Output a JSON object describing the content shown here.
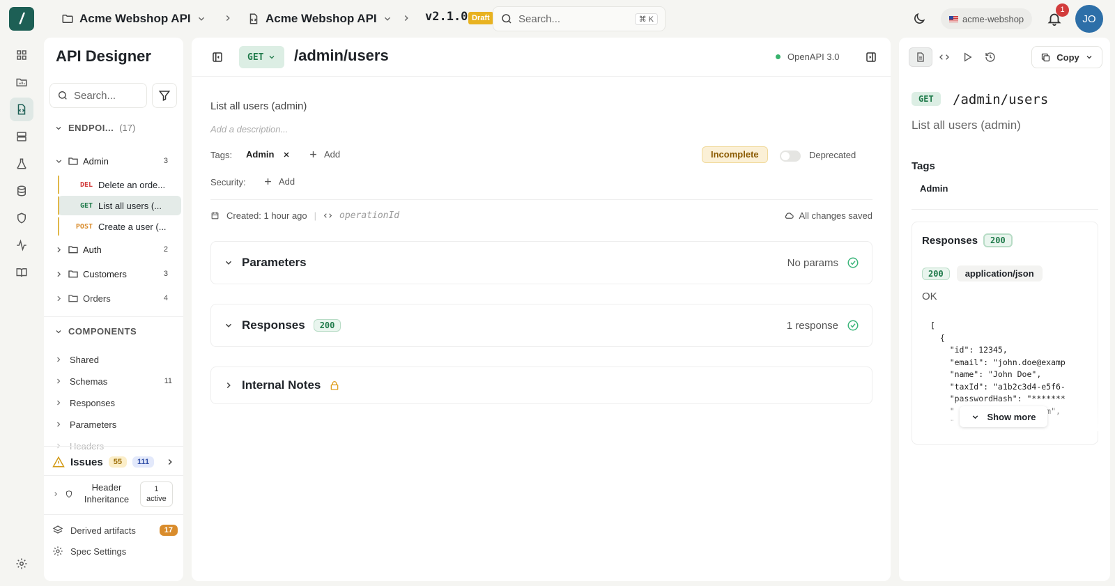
{
  "topbar": {
    "crumbs": [
      "Acme Webshop API",
      "Acme Webshop API"
    ],
    "version": "v2.1.0",
    "status_badge": "Draft",
    "search_placeholder": "Search...",
    "search_shortcut": "⌘ K",
    "workspace": "acme-webshop",
    "notification_count": "1",
    "avatar_initials": "JO"
  },
  "sidebar": {
    "title": "API Designer",
    "search_placeholder": "Search...",
    "endpoints_label": "ENDPOI...",
    "endpoints_count": "(17)",
    "groups": [
      {
        "name": "Admin",
        "count": "3"
      },
      {
        "name": "Auth",
        "count": "2"
      },
      {
        "name": "Customers",
        "count": "3"
      },
      {
        "name": "Orders",
        "count": "4"
      }
    ],
    "admin_endpoints": [
      {
        "method": "DEL",
        "label": "Delete an orde...",
        "color": "#d23c3c"
      },
      {
        "method": "GET",
        "label": "List all users (...",
        "color": "#1f7a4a"
      },
      {
        "method": "POST",
        "label": "Create a user (...",
        "color": "#d98c2c"
      }
    ],
    "components_label": "COMPONENTS",
    "components": [
      {
        "name": "Shared",
        "count": ""
      },
      {
        "name": "Schemas",
        "count": "11"
      },
      {
        "name": "Responses",
        "count": ""
      },
      {
        "name": "Parameters",
        "count": ""
      },
      {
        "name": "Headers",
        "count": ""
      }
    ],
    "issues_label": "Issues",
    "issues_warn": "55",
    "issues_info": "111",
    "header_inheritance_label": "Header Inheritance",
    "header_inheritance_badge_1": "1",
    "header_inheritance_badge_2": "active",
    "derived_label": "Derived artifacts",
    "derived_count": "17",
    "spec_settings_label": "Spec Settings"
  },
  "main": {
    "method": "GET",
    "path": "/admin/users",
    "openapi": "OpenAPI 3.0",
    "summary": "List all users (admin)",
    "description_placeholder": "Add a description...",
    "tags_label": "Tags:",
    "tag": "Admin",
    "add_label": "Add",
    "security_label": "Security:",
    "incomplete": "Incomplete",
    "deprecated": "Deprecated",
    "created": "Created: 1 hour ago",
    "operation_id_placeholder": "operationId",
    "saved": "All changes saved",
    "parameters_title": "Parameters",
    "parameters_status": "No params",
    "responses_title": "Responses",
    "responses_code": "200",
    "responses_status": "1 response",
    "notes_title": "Internal Notes"
  },
  "preview": {
    "copy_label": "Copy",
    "method": "GET",
    "path": "/admin/users",
    "summary": "List all users (admin)",
    "tags_title": "Tags",
    "tag": "Admin",
    "responses_title": "Responses",
    "response_code": "200",
    "content_type": "application/json",
    "status_text": "OK",
    "code_sample": "[\n  {\n    \"id\": 12345,\n    \"email\": \"john.doe@examp\n    \"name\": \"John Doe\",\n    \"taxId\": \"a1b2c3d4-e5f6-\n    \"passwordHash\": \"*******\n    \"                 sum\",\n    \"",
    "show_more": "Show more"
  },
  "colors": {
    "brand": "#1d5f55",
    "get": "#1f7a4a",
    "delete": "#d23c3c",
    "post": "#d98c2c",
    "draft": "#e8b220"
  }
}
